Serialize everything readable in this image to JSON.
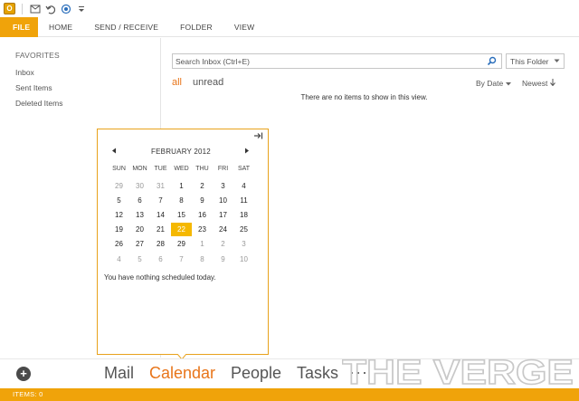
{
  "quick_access": {
    "app_icon_letter": "O",
    "icons": [
      "send-receive-icon",
      "undo-icon",
      "touch-mode-icon",
      "customize-icon"
    ]
  },
  "ribbon": {
    "tabs": [
      "FILE",
      "HOME",
      "SEND / RECEIVE",
      "FOLDER",
      "VIEW"
    ]
  },
  "folder_pane": {
    "favorites_label": "FAVORITES",
    "items": [
      "Inbox",
      "Sent Items",
      "Deleted Items"
    ]
  },
  "mail_list": {
    "search_placeholder": "Search Inbox (Ctrl+E)",
    "scope": "This Folder",
    "filters": [
      "all",
      "unread"
    ],
    "sort_by": "By Date",
    "sort_order": "Newest",
    "empty_message": "There are no items to show in this view."
  },
  "calendar_peek": {
    "month_label": "FEBRUARY 2012",
    "weekdays": [
      "SUN",
      "MON",
      "TUE",
      "WED",
      "THU",
      "FRI",
      "SAT"
    ],
    "weeks": [
      [
        "29",
        "30",
        "31",
        "1",
        "2",
        "3",
        "4"
      ],
      [
        "5",
        "6",
        "7",
        "8",
        "9",
        "10",
        "11"
      ],
      [
        "12",
        "13",
        "14",
        "15",
        "16",
        "17",
        "18"
      ],
      [
        "19",
        "20",
        "21",
        "22",
        "23",
        "24",
        "25"
      ],
      [
        "26",
        "27",
        "28",
        "29",
        "1",
        "2",
        "3"
      ],
      [
        "4",
        "5",
        "6",
        "7",
        "8",
        "9",
        "10"
      ]
    ],
    "today": "22",
    "nothing_scheduled": "You have nothing scheduled today."
  },
  "navigation": {
    "items": [
      "Mail",
      "Calendar",
      "People",
      "Tasks"
    ],
    "active": "Calendar",
    "more": "···"
  },
  "status_bar": {
    "items_label": "ITEMS: 0"
  },
  "watermark": {
    "text": "THE VERGE"
  },
  "colors": {
    "accent": "#f0a30a",
    "nav_active": "#e8751a",
    "today": "#f5b800"
  }
}
